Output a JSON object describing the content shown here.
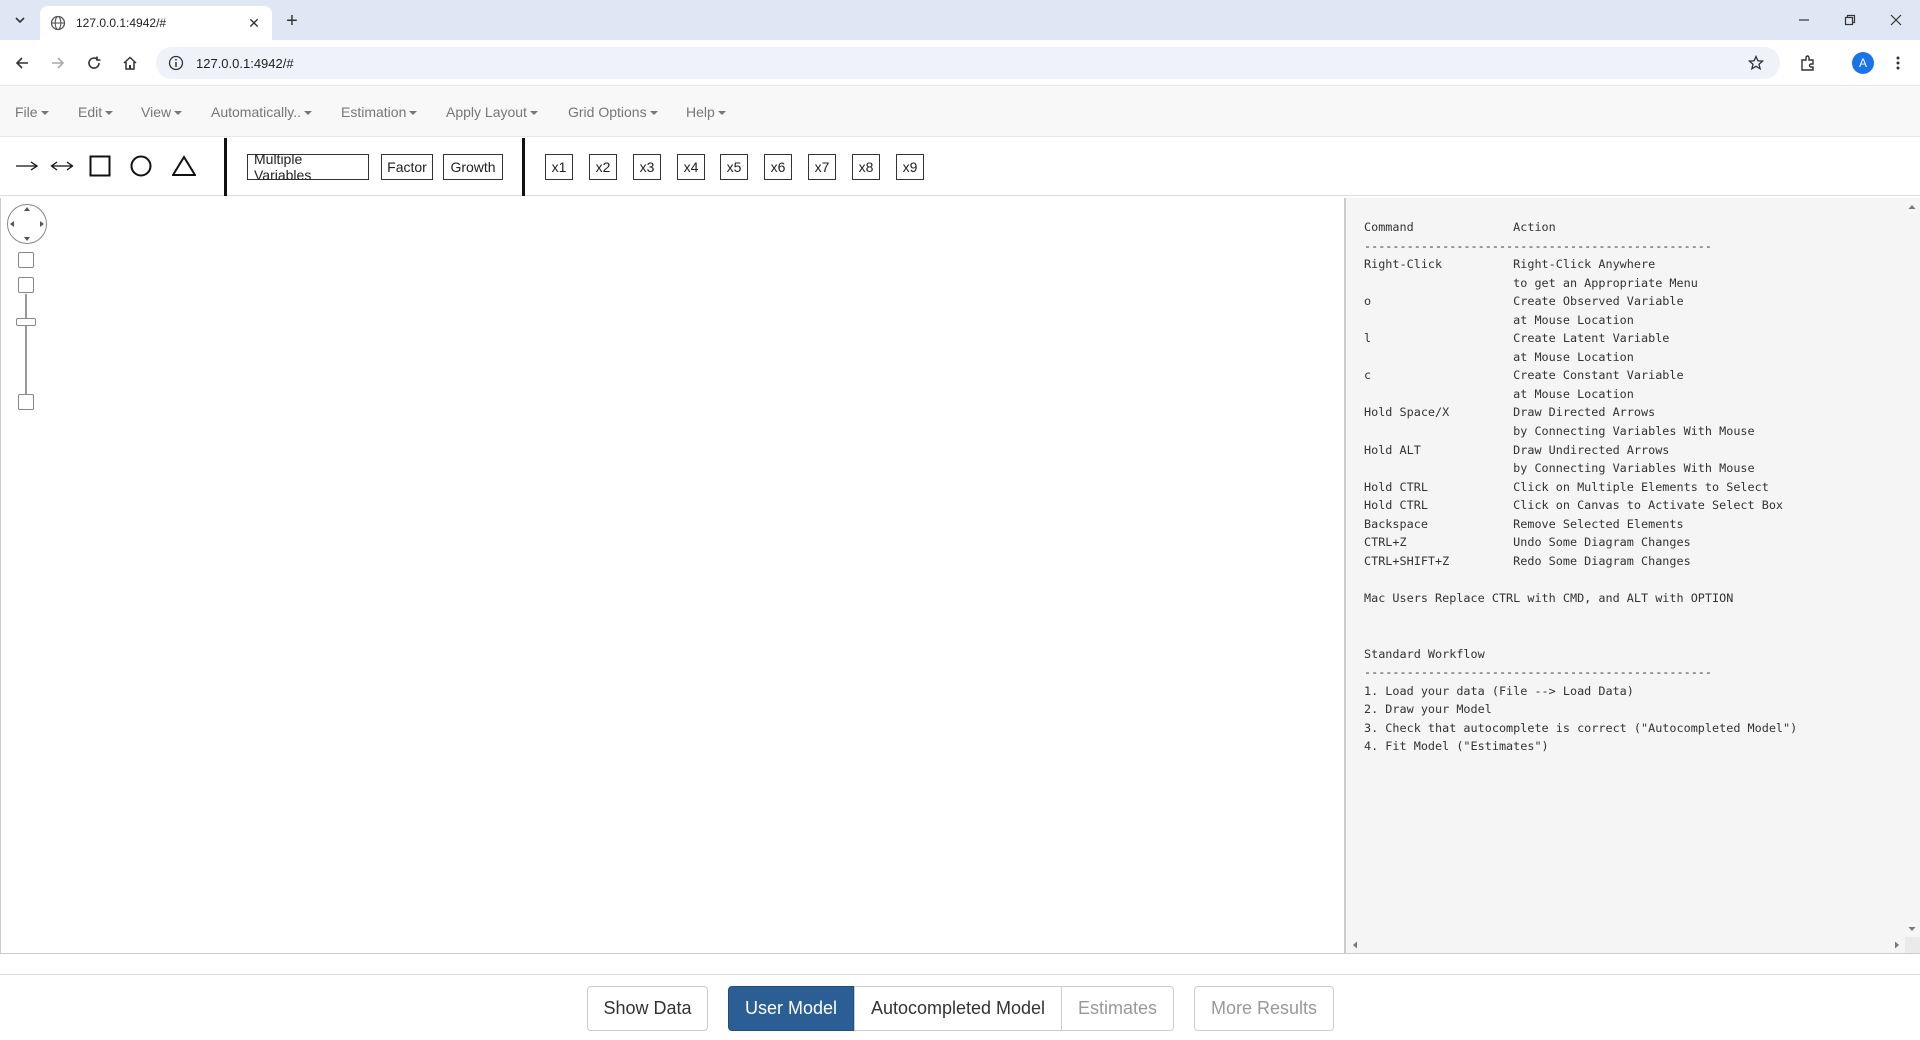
{
  "browser": {
    "tab_title": "127.0.0.1:4942/#",
    "url": "127.0.0.1:4942/#",
    "avatar_letter": "A"
  },
  "menu": {
    "items": [
      "File",
      "Edit",
      "View",
      "Automatically..",
      "Estimation",
      "Apply Layout",
      "Grid Options",
      "Help"
    ]
  },
  "toolbar": {
    "tools": [
      "directed-arrow",
      "undirected-arrow",
      "square",
      "circle",
      "triangle"
    ],
    "group_buttons": [
      "Multiple Variables",
      "Factor",
      "Growth"
    ],
    "variable_buttons": [
      "x1",
      "x2",
      "x3",
      "x4",
      "x5",
      "x6",
      "x7",
      "x8",
      "x9"
    ]
  },
  "help": {
    "text": "Command              Action\n-------------------------------------------------\nRight-Click          Right-Click Anywhere\n                     to get an Appropriate Menu\no                    Create Observed Variable\n                     at Mouse Location\nl                    Create Latent Variable\n                     at Mouse Location\nc                    Create Constant Variable\n                     at Mouse Location\nHold Space/X         Draw Directed Arrows\n                     by Connecting Variables With Mouse\nHold ALT             Draw Undirected Arrows\n                     by Connecting Variables With Mouse\nHold CTRL            Click on Multiple Elements to Select\nHold CTRL            Click on Canvas to Activate Select Box\nBackspace            Remove Selected Elements\nCTRL+Z               Undo Some Diagram Changes\nCTRL+SHIFT+Z         Redo Some Diagram Changes\n\nMac Users Replace CTRL with CMD, and ALT with OPTION\n\n\nStandard Workflow\n-------------------------------------------------\n1. Load your data (File --> Load Data)\n2. Draw your Model\n3. Check that autocomplete is correct (\"Autocompleted Model\")\n4. Fit Model (\"Estimates\")"
  },
  "bottom_tabs": {
    "show_data": "Show Data",
    "user_model": "User Model",
    "autocompleted_model": "Autocompleted Model",
    "estimates": "Estimates",
    "more_results": "More Results"
  },
  "colors": {
    "active_tab": "#2a5e95",
    "tabstrip": "#dfe7f5"
  }
}
